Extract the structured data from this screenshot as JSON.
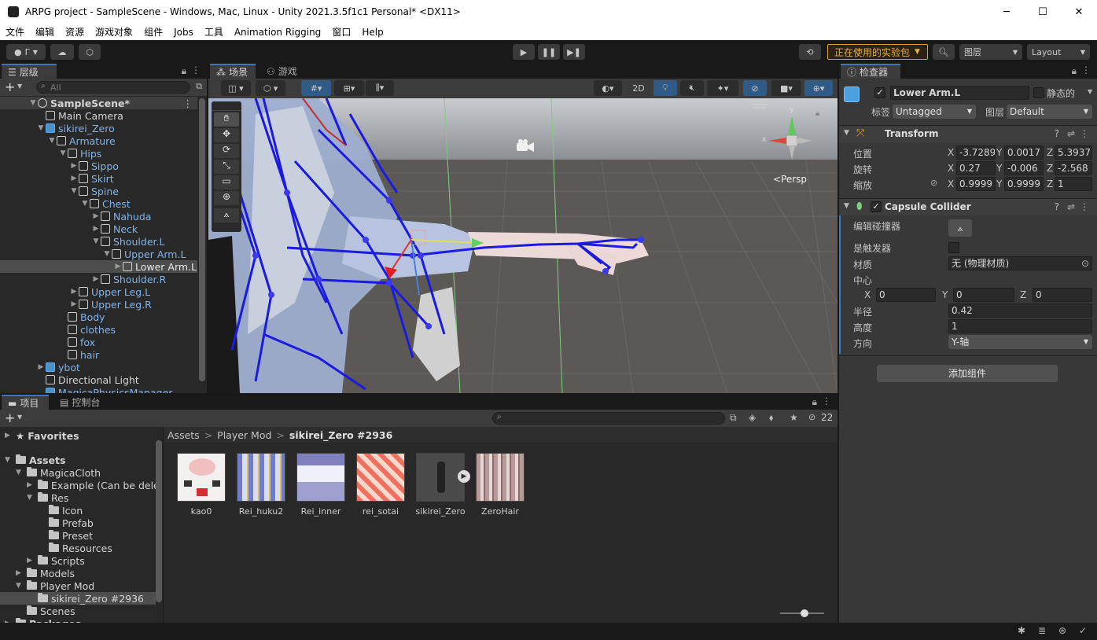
{
  "window": {
    "title": "ARPG project - SampleScene - Windows, Mac, Linux - Unity 2021.3.5f1c1 Personal* <DX11>",
    "minimize": "─",
    "maximize": "☐",
    "close": "✕"
  },
  "menu": [
    "文件",
    "编辑",
    "资源",
    "游戏对象",
    "组件",
    "Jobs",
    "工具",
    "Animation Rigging",
    "窗口",
    "Help"
  ],
  "toolbar": {
    "account_label": "Γ",
    "experimental_label": "正在使用的实验包",
    "layers_label": "图层",
    "layout_label": "Layout"
  },
  "hierarchy": {
    "tab_label": "层级",
    "search_placeholder": "All",
    "rows": [
      {
        "label": "SampleScene*",
        "indent": 0,
        "arrow": "▼",
        "kind": "scene"
      },
      {
        "label": "Main Camera",
        "indent": 1,
        "arrow": "",
        "kind": "object"
      },
      {
        "label": "sikirei_Zero",
        "indent": 1,
        "arrow": "▼",
        "kind": "prefab-root"
      },
      {
        "label": "Armature",
        "indent": 2,
        "arrow": "▼",
        "kind": "prefab"
      },
      {
        "label": "Hips",
        "indent": 3,
        "arrow": "▼",
        "kind": "prefab"
      },
      {
        "label": "Sippo",
        "indent": 4,
        "arrow": "▶",
        "kind": "prefab"
      },
      {
        "label": "Skirt",
        "indent": 4,
        "arrow": "▶",
        "kind": "prefab"
      },
      {
        "label": "Spine",
        "indent": 4,
        "arrow": "▼",
        "kind": "prefab"
      },
      {
        "label": "Chest",
        "indent": 5,
        "arrow": "▼",
        "kind": "prefab"
      },
      {
        "label": "Nahuda",
        "indent": 6,
        "arrow": "▶",
        "kind": "prefab"
      },
      {
        "label": "Neck",
        "indent": 6,
        "arrow": "▶",
        "kind": "prefab"
      },
      {
        "label": "Shoulder.L",
        "indent": 6,
        "arrow": "▼",
        "kind": "prefab"
      },
      {
        "label": "Upper Arm.L",
        "indent": 7,
        "arrow": "▼",
        "kind": "prefab"
      },
      {
        "label": "Lower Arm.L",
        "indent": 8,
        "arrow": "▶",
        "kind": "selected"
      },
      {
        "label": "Shoulder.R",
        "indent": 6,
        "arrow": "▶",
        "kind": "prefab"
      },
      {
        "label": "Upper Leg.L",
        "indent": 4,
        "arrow": "▶",
        "kind": "prefab"
      },
      {
        "label": "Upper Leg.R",
        "indent": 4,
        "arrow": "▶",
        "kind": "prefab"
      },
      {
        "label": "Body",
        "indent": 3,
        "arrow": "",
        "kind": "prefab"
      },
      {
        "label": "clothes",
        "indent": 3,
        "arrow": "",
        "kind": "prefab"
      },
      {
        "label": "fox",
        "indent": 3,
        "arrow": "",
        "kind": "prefab"
      },
      {
        "label": "hair",
        "indent": 3,
        "arrow": "",
        "kind": "prefab"
      },
      {
        "label": "ybot",
        "indent": 1,
        "arrow": "▶",
        "kind": "prefab-root"
      },
      {
        "label": "Directional Light",
        "indent": 1,
        "arrow": "",
        "kind": "object"
      },
      {
        "label": "MagicaPhysicsManager",
        "indent": 1,
        "arrow": "",
        "kind": "prefab-root"
      }
    ]
  },
  "scene": {
    "tab_scene": "场景",
    "tab_game": "游戏",
    "btn_2d": "2D",
    "persp_label": "<Persp",
    "gizmo_x": "x",
    "gizmo_y": "y"
  },
  "inspector": {
    "tab_label": "检查器",
    "object_name": "Lower Arm.L",
    "static_label": "静态的",
    "tag_label": "标签",
    "tag_value": "Untagged",
    "layer_label": "图层",
    "layer_value": "Default",
    "transform": {
      "title": "Transform",
      "position_label": "位置",
      "rotation_label": "旋转",
      "scale_label": "缩放",
      "position": {
        "x": "-3.7289",
        "y": "0.0017",
        "z": "5.3937"
      },
      "rotation": {
        "x": "0.27",
        "y": "-0.006",
        "z": "-2.568"
      },
      "scale": {
        "x": "0.9999",
        "y": "0.9999",
        "z": "1"
      }
    },
    "capsule": {
      "title": "Capsule Collider",
      "edit_collider_label": "编辑碰撞器",
      "is_trigger_label": "是触发器",
      "material_label": "材质",
      "material_value": "无 (物理材质)",
      "center_label": "中心",
      "center": {
        "x": "0",
        "y": "0",
        "z": "0"
      },
      "radius_label": "半径",
      "radius_value": "0.42",
      "height_label": "高度",
      "height_value": "1",
      "direction_label": "方向",
      "direction_value": "Y-轴"
    },
    "add_component_label": "添加组件",
    "axis_x": "X",
    "axis_y": "Y",
    "axis_z": "Z"
  },
  "project": {
    "tab_project": "项目",
    "tab_console": "控制台",
    "hidden_count": "22",
    "breadcrumb": [
      "Assets",
      "Player Mod",
      "sikirei_Zero #2936"
    ],
    "breadcrumb_sep": ">",
    "tree": [
      {
        "label": "Favorites",
        "indent": 0,
        "arrow": "▶",
        "kind": "star"
      },
      {
        "label": "Assets",
        "indent": 0,
        "arrow": "▼",
        "kind": "folder-bold"
      },
      {
        "label": "MagicaCloth",
        "indent": 1,
        "arrow": "▼",
        "kind": "folder"
      },
      {
        "label": "Example (Can be delet",
        "indent": 2,
        "arrow": "▶",
        "kind": "folder"
      },
      {
        "label": "Res",
        "indent": 2,
        "arrow": "▼",
        "kind": "folder"
      },
      {
        "label": "Icon",
        "indent": 3,
        "arrow": "",
        "kind": "folder"
      },
      {
        "label": "Prefab",
        "indent": 3,
        "arrow": "",
        "kind": "folder"
      },
      {
        "label": "Preset",
        "indent": 3,
        "arrow": "",
        "kind": "folder"
      },
      {
        "label": "Resources",
        "indent": 3,
        "arrow": "",
        "kind": "folder"
      },
      {
        "label": "Scripts",
        "indent": 2,
        "arrow": "▶",
        "kind": "folder"
      },
      {
        "label": "Models",
        "indent": 1,
        "arrow": "▶",
        "kind": "folder"
      },
      {
        "label": "Player Mod",
        "indent": 1,
        "arrow": "▼",
        "kind": "folder"
      },
      {
        "label": "sikirei_Zero #2936",
        "indent": 2,
        "arrow": "",
        "kind": "folder-selected"
      },
      {
        "label": "Scenes",
        "indent": 1,
        "arrow": "",
        "kind": "folder"
      },
      {
        "label": "Packages",
        "indent": 0,
        "arrow": "▶",
        "kind": "folder-bold"
      }
    ],
    "assets": [
      "kao0",
      "Rei_huku2",
      "Rei_inner",
      "rei_sotai",
      "sikirei_Zero",
      "ZeroHair"
    ]
  },
  "colors": {
    "accent_blue": "#3a79bb",
    "prefab_blue": "#7fb4ee",
    "panel_bg": "#282828",
    "inspector_bg": "#383838",
    "warning_orange": "#e8b040"
  }
}
